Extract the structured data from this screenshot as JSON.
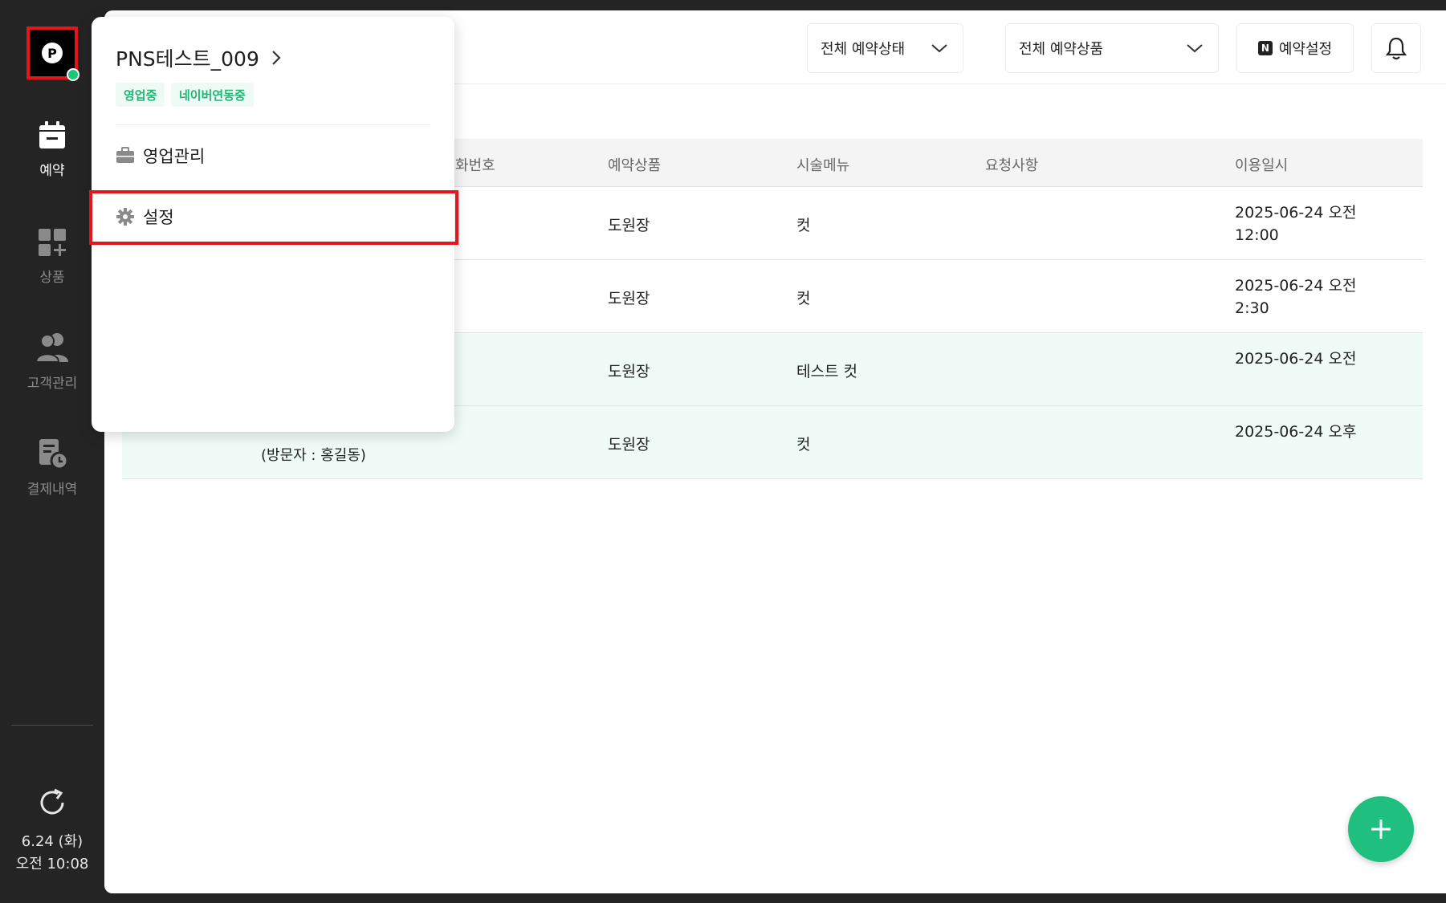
{
  "sidebar": {
    "logo_letter": "P",
    "nav": [
      {
        "label": "예약",
        "icon": "calendar-icon",
        "active": true
      },
      {
        "label": "상품",
        "icon": "grid-plus-icon",
        "active": false
      },
      {
        "label": "고객관리",
        "icon": "people-icon",
        "active": false
      },
      {
        "label": "결제내역",
        "icon": "receipt-clock-icon",
        "active": false
      }
    ],
    "date": "6.24 (화)",
    "time": "오전 10:08"
  },
  "topbar": {
    "status_filter": "전체 예약상태",
    "product_filter": "전체 예약상품",
    "settings_badge": "N",
    "settings_button": "예약설정"
  },
  "table": {
    "headers": {
      "phone": "화번호",
      "product": "예약상품",
      "menu": "시술메뉴",
      "request": "요청사항",
      "datetime": "이용일시"
    },
    "rows": [
      {
        "visitor": "",
        "product": "도원장",
        "menu": "컷",
        "date_line1": "2025-06-24 오전",
        "date_line2": "12:00"
      },
      {
        "visitor": "",
        "product": "도원장",
        "menu": "컷",
        "date_line1": "2025-06-24 오전",
        "date_line2": "2:30"
      },
      {
        "visitor": "",
        "product": "도원장",
        "menu": "테스트 컷",
        "date_line1": "2025-06-24 오전",
        "date_line2": ""
      },
      {
        "visitor": "(방문자 : 홍길동)",
        "product": "도원장",
        "menu": "컷",
        "date_line1": "2025-06-24 오후",
        "date_line2": ""
      }
    ]
  },
  "popover": {
    "store_name": "PNS테스트_009",
    "tags": [
      "영업중",
      "네이버연동중"
    ],
    "menu": [
      {
        "label": "영업관리",
        "icon": "briefcase-icon"
      },
      {
        "label": "설정",
        "icon": "gear-icon"
      }
    ]
  },
  "colors": {
    "accent_green": "#1fbf7f",
    "highlight_red": "#e8141b",
    "sidebar_bg": "#242424"
  }
}
